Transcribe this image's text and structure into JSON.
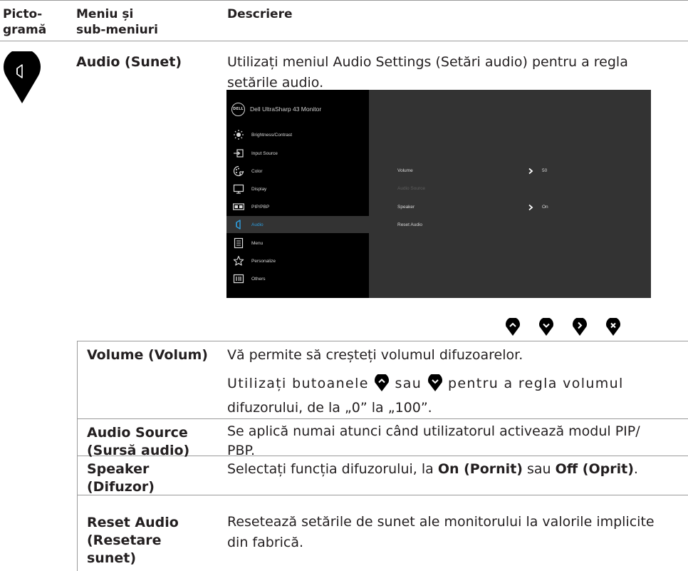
{
  "header": {
    "col1": [
      "Picto-",
      "gramă"
    ],
    "col2": [
      "Meniu și",
      "sub-meniuri"
    ],
    "col3": "Descriere"
  },
  "audio": {
    "menu_label": "Audio (Sunet)",
    "description": [
      "Utilizați meniul Audio Settings (Setări audio) pentru a regla",
      "setările audio."
    ],
    "icon": "speaker-icon"
  },
  "osd": {
    "brand": "Dell UltraSharp 43 Monitor",
    "logo": "DELL",
    "menu_items": [
      {
        "label": "Brightness/Contrast",
        "icon": "brightness-icon"
      },
      {
        "label": "Input Source",
        "icon": "input-source-icon"
      },
      {
        "label": "Color",
        "icon": "color-icon"
      },
      {
        "label": "Display",
        "icon": "display-icon"
      },
      {
        "label": "PIP/PBP",
        "icon": "pip-pbp-icon"
      },
      {
        "label": "Audio",
        "icon": "audio-icon",
        "selected": true
      },
      {
        "label": "Menu",
        "icon": "menu-icon"
      },
      {
        "label": "Personalize",
        "icon": "star-icon"
      },
      {
        "label": "Others",
        "icon": "others-icon"
      }
    ],
    "submenu": [
      {
        "label": "Volume",
        "value": "50"
      },
      {
        "label": "Audio Source",
        "disabled": true
      },
      {
        "label": "Speaker",
        "value": "On"
      },
      {
        "label": "Reset Audio"
      }
    ]
  },
  "nav_buttons": [
    "up-button",
    "down-button",
    "right-button",
    "close-button"
  ],
  "rows": [
    {
      "label": "Volume (Volum)",
      "line1": "Vă permite să creșteți volumul difuzoarelor.",
      "line2_a": "Utilizați butoanele",
      "line2_b": "sau",
      "line2_c": "pentru a regla volumul",
      "line3": "difuzorului, de la „0” la „100”."
    },
    {
      "label": [
        "Audio Source",
        "(Sursă audio)"
      ],
      "desc": [
        "Se aplică numai atunci când utilizatorul activează modul PIP/",
        "PBP."
      ]
    },
    {
      "label": [
        "Speaker",
        "(Difuzor)"
      ],
      "desc_a": "Selectați funcția difuzorului, la ",
      "desc_on": "On (Pornit)",
      "desc_b": " sau ",
      "desc_off": "Off (Oprit)",
      "desc_c": "."
    },
    {
      "label": [
        "Reset Audio",
        "(Resetare",
        "sunet)"
      ],
      "desc": [
        "Resetează setările de sunet ale monitorului la valorile implicite",
        "din fabrică."
      ]
    }
  ],
  "colors": {
    "text": "#231f20",
    "osd_bg": "#000000",
    "osd_panel": "#333333",
    "osd_selected": "#2f9fe0",
    "rule": "#9a9a9a"
  }
}
